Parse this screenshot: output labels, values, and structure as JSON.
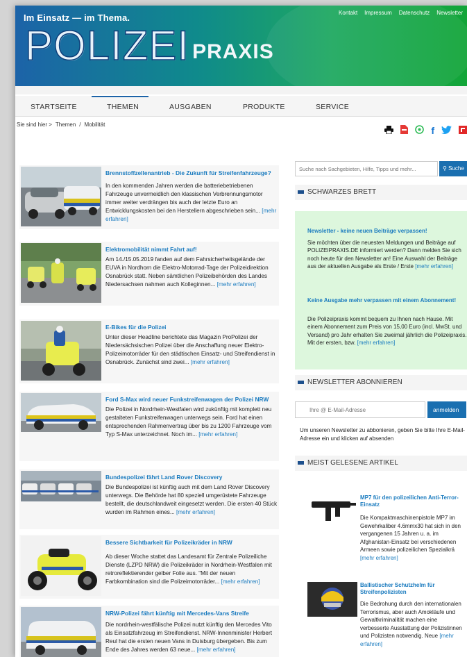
{
  "header": {
    "tagline": "Im Einsatz — im Thema.",
    "logo_big": "POLIZEI",
    "logo_small": "PRAXIS",
    "links": [
      "Kontakt",
      "Impressum",
      "Datenschutz",
      "Newsletter"
    ]
  },
  "nav": {
    "items": [
      "STARTSEITE",
      "THEMEN",
      "AUSGABEN",
      "PRODUKTE",
      "SERVICE"
    ],
    "active": "THEMEN"
  },
  "breadcrumb": {
    "prefix": "Sie sind hier >",
    "items": [
      "Themen",
      "/",
      "Mobilität"
    ]
  },
  "share_icons": [
    "print-icon",
    "pdf-icon",
    "whatsapp-icon",
    "facebook-icon",
    "twitter-icon",
    "flipboard-icon"
  ],
  "articles": [
    {
      "title": "Brennstoffzellenantrieb - Die Zukunft für Streifenfahrzeuge?",
      "text": "In den kommenden Jahren werden die batteriebetriebenen Fahrzeuge unvermeidlich den klassischen Verbrennungsmotor immer weiter verdrängen bis auch der letzte Euro an Entwicklungskosten bei den Herstellern abgeschrieben sein...",
      "more": "[mehr erfahren]"
    },
    {
      "title": "Elektromobilität nimmt Fahrt auf!",
      "text": "Am 14./15.05.2019 fanden auf dem Fahrsicherheitsgelände der EUVA in Nordhorn die Elektro-Motorrad-Tage der Polizeidirektion Osnabrück statt. Neben sämtlichen Polizeibehörden des Landes Niedersachsen nahmen auch Kolleginnen...",
      "more": "[mehr erfahren]"
    },
    {
      "title": "E-Bikes für die Polizei",
      "text": "Unter dieser Headline berichtete das Magazin ProPolizei der Niedersächsischen Polizei über die Anschaffung neuer Elektro-Polizeimotorräder für den städtischen Einsatz- und Streifendienst in Osnabrück.  Zunächst sind zwei...",
      "more": "[mehr erfahren]"
    },
    {
      "title": "Ford S-Max wird neuer Funkstreifenwagen der Polizei NRW",
      "text": "Die Polizei in Nordrhein-Westfalen wird zukünftig mit komplett neu gestalteten Funkstreifenwagen unterwegs sein.  Ford hat einen entsprechenden Rahmenvertrag über bis zu 1200 Fahrzeuge vom Typ S-Max unterzeichnet. Noch im...",
      "more": "[mehr erfahren]"
    },
    {
      "title": "Bundespolizei fährt Land Rover Discovery",
      "text": "Die Bundespolizei ist künftig auch mit dem Land Rover Discovery unterwegs. Die Behörde hat 80 speziell umgerüstete Fahrzeuge bestellt, die deutschlandweit eingesetzt werden.  Die ersten 40 Stück wurden im Rahmen eines...",
      "more": "[mehr erfahren]"
    },
    {
      "title": "Bessere Sichtbarkeit für Polizeikräder in NRW",
      "text": "Ab dieser Woche stattet das Landesamt für Zentrale Polizeiliche Dienste (LZPD NRW) die Polizeikräder in Nordrhein-Westfalen mit retroreflektierender gelber Folie aus. \"Mit der neuen Farbkombination sind die Polizeimotorräder...",
      "more": "[mehr erfahren]"
    },
    {
      "title": "NRW-Polizei fährt künftig mit Mercedes-Vans Streife",
      "text": "Die nordrhein-westfälische Polizei nutzt künftig den Mercedes Vito als Einsatzfahrzeug im Streifendienst. NRW-Innenminister Herbert Reul hat die ersten neuen Vans in Duisburg übergeben. Bis zum Ende des Jahres werden 63 neue...",
      "more": "[mehr erfahren]"
    }
  ],
  "search": {
    "placeholder": "Suche nach Sachgebieten, Hilfe, Tipps und mehr...",
    "button": "Suche"
  },
  "sidebar": {
    "brett_title": "SCHWARZES BRETT",
    "brett": [
      {
        "heading": "Newsletter - keine neuen Beiträge verpassen!",
        "text": "Sie möchten über die neuesten Meldungen und Beiträge auf POLIZEIPRAXIS.DE informiert werden? Dann melden Sie sich noch heute für den Newsletter an! Eine Auswahl der Beiträge aus der aktuellen Ausgabe als Erste / Erste",
        "more": "[mehr erfahren]"
      },
      {
        "heading": "Keine Ausgabe mehr verpassen mit einem Abonnement!",
        "text": "Die Polizeipraxis kommt bequem zu Ihnen nach  Hause. Mit einem Abonnement zum Preis von 15,00 Euro (incl. MwSt. und Versand) pro Jahr erhalten Sie zweimal jährlich die Polizeipraxis.  Mit der ersten, bzw.",
        "more": "[mehr erfahren]"
      }
    ],
    "newsletter_title": "NEWSLETTER ABONNIEREN",
    "newsletter_placeholder": "Ihre @ E-Mail-Adresse",
    "newsletter_button": "anmelden",
    "newsletter_text": "Um unseren Newsletter zu abbonieren, geben Sie bitte Ihre E-Mail-Adresse ein und klicken auf absenden",
    "top_title": "MEIST GELESENE ARTIKEL",
    "top": [
      {
        "title": "MP7 für den polizeilichen Anti-Terror-Einsatz",
        "text": "Die Kompaktmaschinenpistole MP7 im Gewehrkaliber 4.6mmx30 hat sich in den vergangenen 15 Jahren u. a. im Afghanistan-Einsatz bei verschiedenen Armeen sowie polizeilichen Spezialkrä",
        "more": "[mehr erfahren]"
      },
      {
        "title": "Ballistischer Schutzhelm für Streifenpolizisten",
        "text": "Die Bedrohung durch den internationalen Terrorismus, aber auch Amokläufe und Gewaltkriminalität machen eine verbesserte Ausstattung der Polizistinnen und Polizisten notwendig. Neue",
        "more": "[mehr erfahren]"
      }
    ]
  },
  "colors": {
    "link": "#1a7bbf",
    "button": "#1a6fb0",
    "board_bg": "#ddf7dd"
  }
}
